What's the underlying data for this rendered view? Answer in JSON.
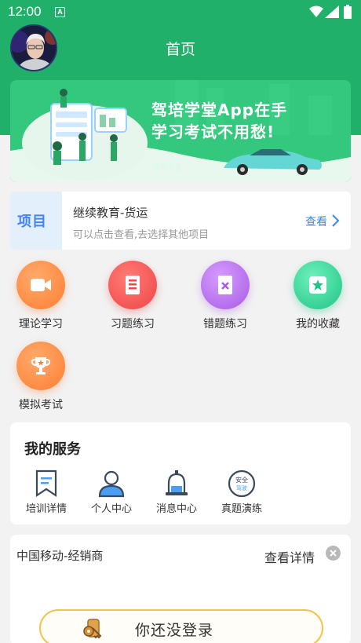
{
  "statusbar": {
    "time": "12:00",
    "badge": "A"
  },
  "header": {
    "title": "首页"
  },
  "banner": {
    "slogan_line1": "驾培学堂App在手",
    "slogan_line2": "学习考试不用愁!",
    "brand": "驾培学堂"
  },
  "project": {
    "badge": "项目",
    "name": "继续教育-货运",
    "hint": "可以点击查看,去选择其他项目",
    "view_label": "查看"
  },
  "functions": [
    {
      "label": "理论学习",
      "icon": "video-camera-icon",
      "color": "#ff8a3d"
    },
    {
      "label": "习题练习",
      "icon": "document-list-icon",
      "color": "#f5524f"
    },
    {
      "label": "错题练习",
      "icon": "wrong-answer-icon",
      "color": "#b469e6"
    },
    {
      "label": "我的收藏",
      "icon": "star-icon",
      "color": "#2fcf8f"
    },
    {
      "label": "模拟考试",
      "icon": "trophy-icon",
      "color": "#ff8a3d"
    }
  ],
  "services": {
    "title": "我的服务",
    "items": [
      {
        "label": "培训详情",
        "icon": "bookmark-icon"
      },
      {
        "label": "个人中心",
        "icon": "user-icon"
      },
      {
        "label": "消息中心",
        "icon": "bell-icon"
      },
      {
        "label": "真题演练",
        "icon": "safety-exam-icon",
        "icon_text_1": "安全",
        "icon_text_2": "驾驶"
      }
    ]
  },
  "login": {
    "org": "中国移动-经销商",
    "detail": "查看详情",
    "button": "你还没登录"
  },
  "colors": {
    "primary": "#21b06a",
    "link": "#3b86f0",
    "login_border": "#f5c44a"
  }
}
